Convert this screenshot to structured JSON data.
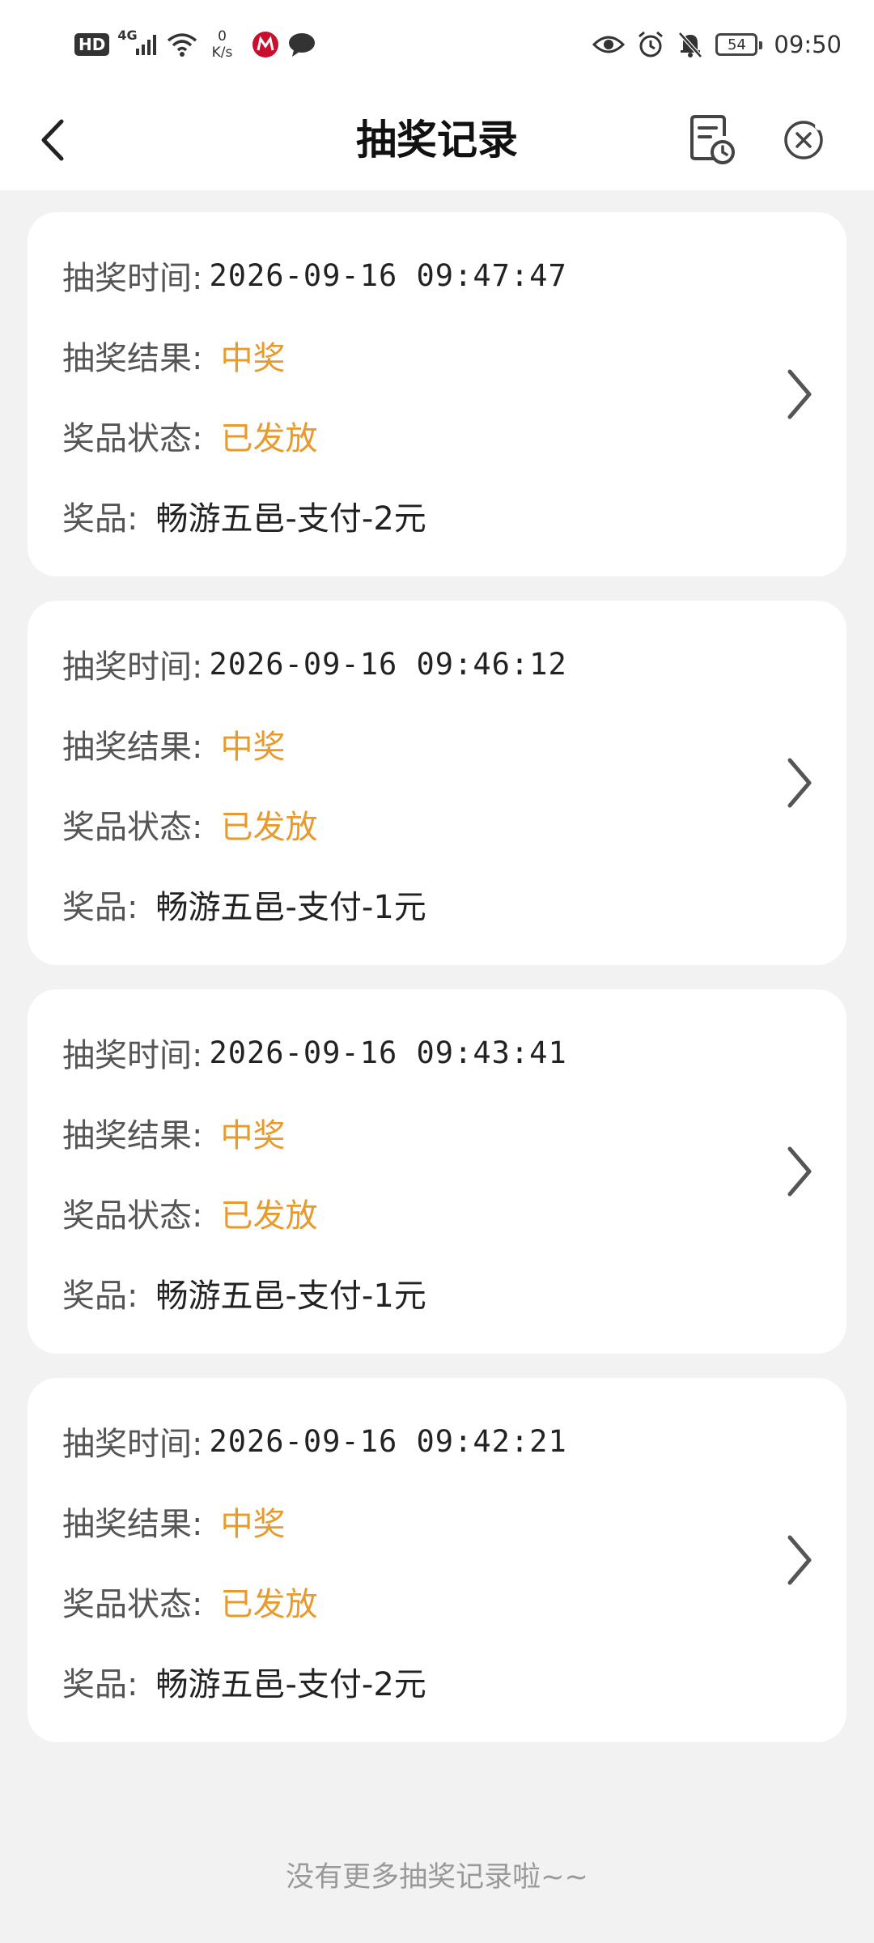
{
  "status_bar": {
    "hd": "HD",
    "net_type": "4G",
    "speed_value": "0",
    "speed_unit": "K/s",
    "battery": "54",
    "time": "09:50"
  },
  "nav": {
    "title": "抽奖记录"
  },
  "labels": {
    "time": "抽奖时间:",
    "result": "抽奖结果:",
    "status": "奖品状态:",
    "prize": "奖品:"
  },
  "records": [
    {
      "time": "2026-09-16 09:47:47",
      "result": "中奖",
      "status": "已发放",
      "prize": "畅游五邑-支付-2元"
    },
    {
      "time": "2026-09-16 09:46:12",
      "result": "中奖",
      "status": "已发放",
      "prize": "畅游五邑-支付-1元"
    },
    {
      "time": "2026-09-16 09:43:41",
      "result": "中奖",
      "status": "已发放",
      "prize": "畅游五邑-支付-1元"
    },
    {
      "time": "2026-09-16 09:42:21",
      "result": "中奖",
      "status": "已发放",
      "prize": "畅游五邑-支付-2元"
    }
  ],
  "footer": {
    "no_more": "没有更多抽奖记录啦~~"
  },
  "colors": {
    "accent": "#e89a2c",
    "background": "#f2f2f2"
  }
}
